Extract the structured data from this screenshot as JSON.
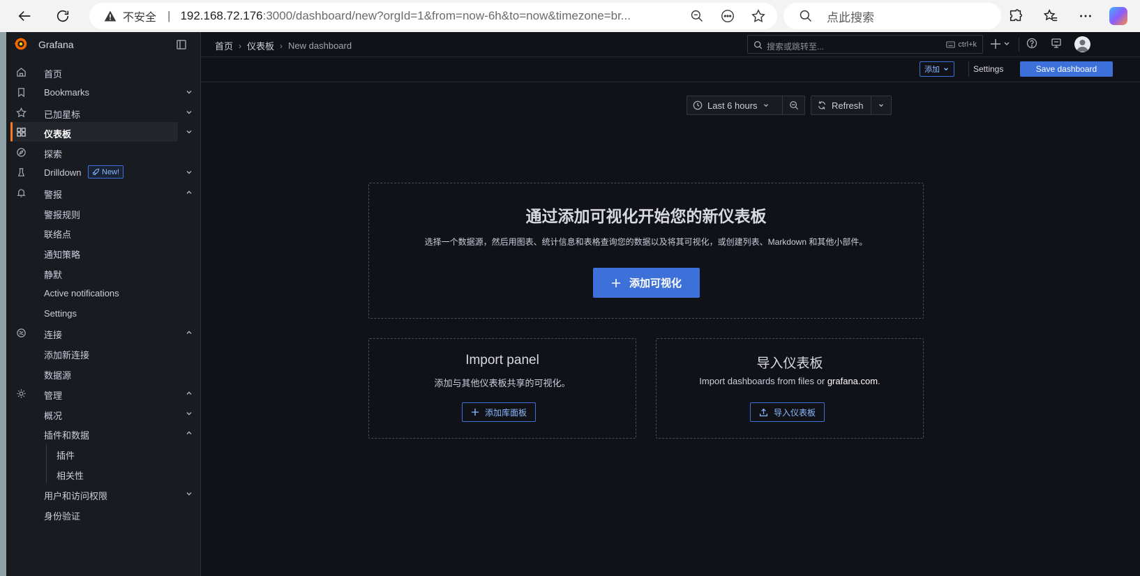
{
  "browser": {
    "security_label": "不安全",
    "url_host": "192.168.72.176",
    "url_path": ":3000/dashboard/new?orgId=1&from=now-6h&to=now&timezone=br...",
    "search_placeholder": "点此搜索"
  },
  "sidebar": {
    "brand": "Grafana",
    "items": {
      "home": "首页",
      "bookmarks": "Bookmarks",
      "starred": "已加星标",
      "dashboards": "仪表板",
      "explore": "探索",
      "drilldown": "Drilldown",
      "drilldown_badge": "New!",
      "alerting": "警报",
      "alert_rules": "警报规则",
      "contact_points": "联络点",
      "notification_policies": "通知策略",
      "silences": "静默",
      "active_notifications": "Active notifications",
      "alert_settings": "Settings",
      "connections": "连接",
      "add_connection": "添加新连接",
      "data_sources": "数据源",
      "administration": "管理",
      "general": "概况",
      "plugins_and_data": "插件和数据",
      "plugins": "插件",
      "correlations": "相关性",
      "users_and_access": "用户和访问权限",
      "authentication": "身份验证"
    }
  },
  "topbar": {
    "breadcrumb": [
      "首页",
      "仪表板",
      "New dashboard"
    ],
    "search_placeholder": "搜索或跳转至...",
    "shortcut": "ctrl+k"
  },
  "toolbar": {
    "add_label": "添加",
    "settings_label": "Settings",
    "save_label": "Save dashboard"
  },
  "time_picker": {
    "range_label": "Last 6 hours",
    "refresh_label": "Refresh"
  },
  "empty_state": {
    "title": "通过添加可视化开始您的新仪表板",
    "description": "选择一个数据源，然后用图表、统计信息和表格查询您的数据以及将其可视化，或创建列表、Markdown 和其他小部件。",
    "add_viz_button": "添加可视化"
  },
  "import_panel": {
    "title": "Import panel",
    "description": "添加与其他仪表板共享的可视化。",
    "button": "添加库面板"
  },
  "import_dashboard": {
    "title": "导入仪表板",
    "description_prefix": "Import dashboards from files or ",
    "description_link": "grafana.com",
    "description_suffix": ".",
    "button": "导入仪表板"
  },
  "colors": {
    "primary": "#3d71d9",
    "accent": "#ff7820",
    "background": "#111217",
    "sidebar": "#181b1f"
  }
}
